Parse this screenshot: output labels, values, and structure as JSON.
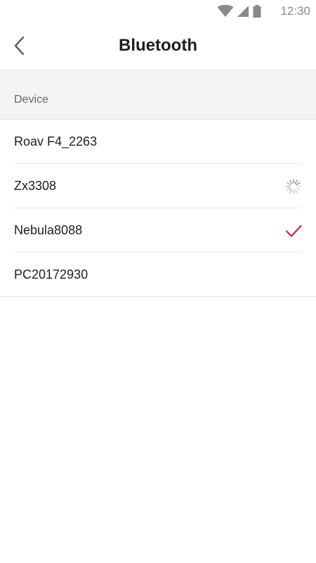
{
  "status_bar": {
    "time": "12:30",
    "icons": [
      "wifi-icon",
      "cell-signal-icon",
      "battery-icon"
    ]
  },
  "header": {
    "title": "Bluetooth",
    "back_icon": "chevron-left-icon"
  },
  "section": {
    "label": "Device"
  },
  "devices": [
    {
      "name": "Roav F4_2263",
      "state": "none"
    },
    {
      "name": "Zx3308",
      "state": "connecting",
      "icon": "spinner-icon"
    },
    {
      "name": "Nebula8088",
      "state": "connected",
      "icon": "checkmark-icon"
    },
    {
      "name": "PC20172930",
      "state": "none"
    }
  ],
  "colors": {
    "accent": "#d0213a",
    "spinner": "#9a9a9a",
    "section_bg": "#f4f4f4",
    "divider": "#e8e8e8"
  }
}
